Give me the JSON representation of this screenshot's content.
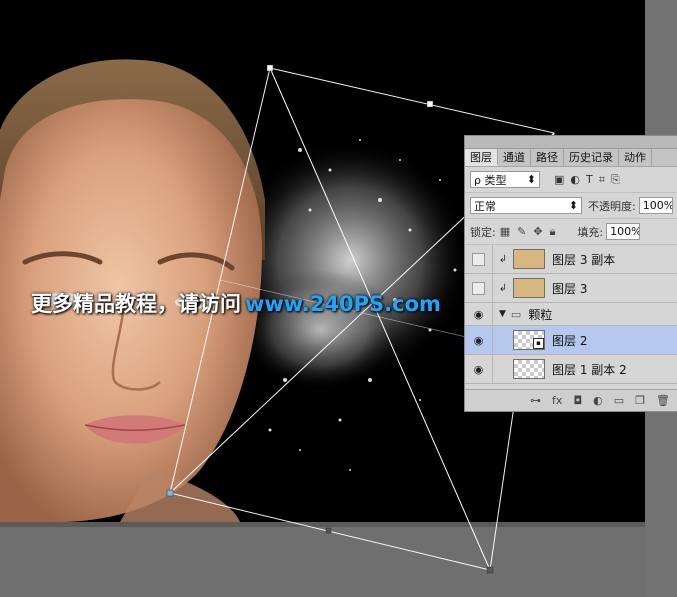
{
  "watermark": {
    "text_cn": "更多精品教程，请访问",
    "text_url": "www.240PS.com"
  },
  "layers_panel": {
    "tabs": [
      {
        "label": "图层",
        "active": true
      },
      {
        "label": "通道",
        "active": false
      },
      {
        "label": "路径",
        "active": false
      },
      {
        "label": "历史记录",
        "active": false
      },
      {
        "label": "动作",
        "active": false
      }
    ],
    "filter": {
      "icon": "search-icon",
      "label": "ρ 类型",
      "arrow": "⬍"
    },
    "filter_icons": [
      "image-filter-icon",
      "adjustment-filter-icon",
      "type-filter-icon",
      "shape-filter-icon",
      "smart-object-filter-icon"
    ],
    "blend_mode": {
      "value": "正常",
      "arrow": "⬍"
    },
    "opacity": {
      "label": "不透明度:",
      "value": "100%"
    },
    "lock": {
      "label": "锁定:"
    },
    "fill": {
      "label": "填充:",
      "value": "100%"
    },
    "layers": [
      {
        "name": "图层 3 副本",
        "visible": false,
        "clipped": true,
        "thumb": "tan",
        "selected": false
      },
      {
        "name": "图层 3",
        "visible": false,
        "clipped": true,
        "thumb": "tan",
        "selected": false
      },
      {
        "name": "颗粒",
        "visible": true,
        "group": true,
        "expanded": true,
        "selected": false
      },
      {
        "name": "图层 2",
        "visible": true,
        "thumb": "checker",
        "smart": true,
        "selected": true
      },
      {
        "name": "图层 1 副本 2",
        "visible": true,
        "thumb": "checker",
        "selected": false
      }
    ],
    "footer_icons": [
      "link-icon",
      "fx-icon",
      "mask-icon",
      "adjustment-icon",
      "folder-icon",
      "new-layer-icon",
      "trash-icon"
    ]
  },
  "colors": {
    "selection_highlight": "#b6c8ed",
    "url_blue": "#1aa7ff",
    "canvas_bg": "#000000"
  }
}
